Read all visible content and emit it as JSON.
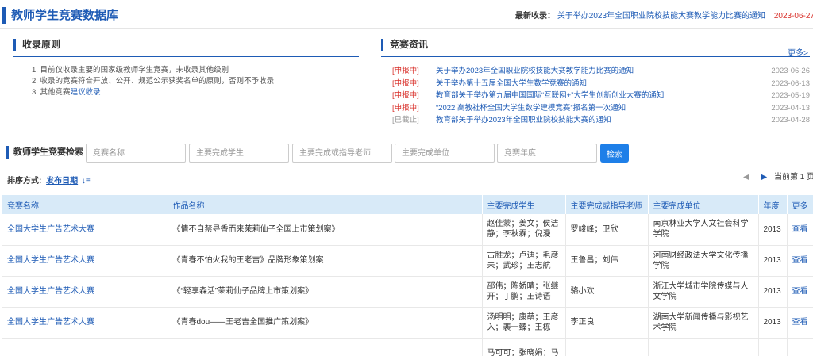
{
  "header": {
    "site_title": "教师学生竞赛数据库",
    "latest_label": "最新收录：",
    "latest_title": "关于举办2023年全国职业院校技能大赛教学能力比赛的通知",
    "latest_date": "2023-06-27"
  },
  "principles": {
    "title": "收录原则",
    "items": [
      "1. 目前仅收录主要的国家级教师学生竞赛，未收录其他级别",
      "2. 收录的竞赛符合开放、公开、规范公示获奖名单的原则，否则不予收录"
    ],
    "item3_prefix": "3. 其他竞赛",
    "item3_link": "建议收录"
  },
  "news": {
    "title": "竞赛资讯",
    "more_label": "更多>",
    "items": [
      {
        "tag": "[申报中]",
        "title": "关于举办2023年全国职业院校技能大赛教学能力比赛的通知",
        "date": "2023-06-26",
        "closed": false
      },
      {
        "tag": "[申报中]",
        "title": "关于举办第十五届全国大学生数学竞赛的通知",
        "date": "2023-06-13",
        "closed": false
      },
      {
        "tag": "[申报中]",
        "title": "教育部关于举办第九届中国国际“互联网+”大学生创新创业大赛的通知",
        "date": "2023-05-19",
        "closed": false
      },
      {
        "tag": "[申报中]",
        "title": "“2022 高教社杯全国大学生数学建模竞赛”报名第一次通知",
        "date": "2023-04-13",
        "closed": false
      },
      {
        "tag": "[已截止]",
        "title": "教育部关于举办2023年全国职业院校技能大赛的通知",
        "date": "2023-04-28",
        "closed": true
      }
    ]
  },
  "search": {
    "label": "教师学生竞赛检索",
    "placeholders": [
      "竞赛名称",
      "主要完成学生",
      "主要完成或指导老师",
      "主要完成单位",
      "竞赛年度"
    ],
    "button_label": "检索"
  },
  "sort": {
    "label": "排序方式:",
    "value": "发布日期"
  },
  "pager": {
    "text": "当前第 1 页"
  },
  "table": {
    "headers": [
      "竞赛名称",
      "作品名称",
      "主要完成学生",
      "主要完成或指导老师",
      "主要完成单位",
      "年度",
      "更多"
    ],
    "rows": [
      {
        "competition": "全国大学生广告艺术大赛",
        "work": "《情不自禁寻香而来茉莉仙子全国上市策划案》",
        "students": "赵佳蒙；姜文；侯洁静；李秋霖；倪漫",
        "teachers": "罗峻峰；卫欣",
        "unit": "南京林业大学人文社会科学学院",
        "year": "2013",
        "more": "查看"
      },
      {
        "competition": "全国大学生广告艺术大赛",
        "work": "《青春不怕火我的王老吉》品牌形象策划案",
        "students": "古胜龙；卢迪；毛彦未；武珍；王志航",
        "teachers": "王鲁昌；刘伟",
        "unit": "河南财经政法大学文化传播学院",
        "year": "2013",
        "more": "查看"
      },
      {
        "competition": "全国大学生广告艺术大赛",
        "work": "《“轻享森活”茉莉仙子品牌上市策划案》",
        "students": "邵伟；陈娇晴；张继开；丁鹏；王诗语",
        "teachers": "骆小欢",
        "unit": "浙江大学城市学院传媒与人文学院",
        "year": "2013",
        "more": "查看"
      },
      {
        "competition": "全国大学生广告艺术大赛",
        "work": "《青春dou——王老吉全国推广策划案》",
        "students": "汤明明；康萌；王彦入；裴一臻；王栋",
        "teachers": "李正良",
        "unit": "湖南大学新闻传播与影视艺术学院",
        "year": "2013",
        "more": "查看"
      },
      {
        "competition": "",
        "work": "",
        "students": "马可可；张晓娟；马",
        "teachers": "",
        "unit": "",
        "year": "",
        "more": ""
      }
    ]
  }
}
